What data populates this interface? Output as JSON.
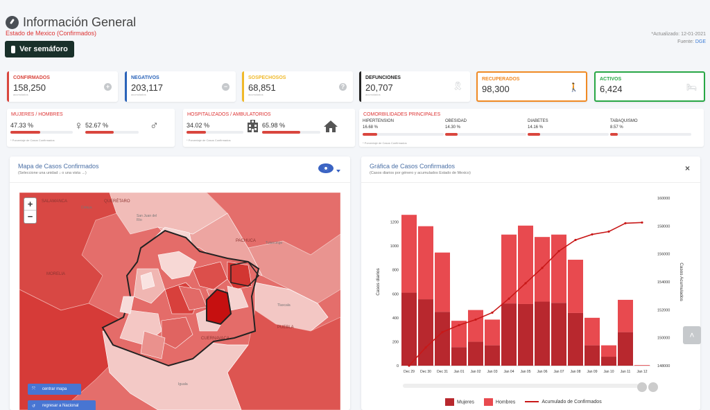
{
  "header": {
    "title": "Información General",
    "subtitle": "Estado de Mexico (Confirmados)",
    "semaforo_button": "Ver semáforo",
    "updated": "*Actualizado: 12-01-2021",
    "source_label": "Fuente:",
    "source_link": "DGE"
  },
  "kpis": [
    {
      "label": "CONFIRMADOS",
      "value": "158,250",
      "note": "acumulados",
      "color": "#d9463e",
      "icon": "plus-circle-icon",
      "glyph": "+"
    },
    {
      "label": "NEGATIVOS",
      "value": "203,117",
      "note": "acumulados",
      "color": "#2a63b9",
      "icon": "minus-circle-icon",
      "glyph": "−"
    },
    {
      "label": "SOSPECHOSOS",
      "value": "68,851",
      "note": "acumulados",
      "color": "#f0b929",
      "icon": "question-circle-icon",
      "glyph": "?"
    },
    {
      "label": "DEFUNCIONES",
      "value": "20,707",
      "note": "acumulados",
      "color": "#222222",
      "icon": "ribbon-icon",
      "glyph": "🎗"
    },
    {
      "label": "RECUPERADOS",
      "value": "98,300",
      "note": "",
      "color": "#f08a24",
      "icon": "walking-icon",
      "glyph": "🚶"
    },
    {
      "label": "ACTIVOS",
      "value": "6,424",
      "note": "",
      "color": "#28a745",
      "icon": "bed-icon",
      "glyph": "🛏"
    }
  ],
  "gender": {
    "title": "MUJERES / HOMBRES",
    "women_pct": "47.33 %",
    "women_value": 47.33,
    "men_pct": "52.67 %",
    "men_value": 52.67,
    "note": "* Porcentaje de Casos Confirmados",
    "women_symbol": "♀",
    "men_symbol": "♂"
  },
  "hosp": {
    "title": "HOSPITALIZADOS / AMBULATORIOS",
    "hosp_pct": "34.02 %",
    "hosp_value": 34.02,
    "amb_pct": "65.98 %",
    "amb_value": 65.98,
    "note": "* Porcentaje de Casos Confirmados",
    "hosp_icon": "hospital-icon",
    "amb_icon": "house-icon"
  },
  "comorb": {
    "title": "COMORBILIDADES PRINCIPALES",
    "note": "* Porcentaje de Casos Confirmados",
    "items": [
      {
        "label": "HIPERTENSION",
        "pct": "16.68 %",
        "value": 16.68
      },
      {
        "label": "OBESIDAD",
        "pct": "14.30 %",
        "value": 14.3
      },
      {
        "label": "DIABETES",
        "pct": "14.16 %",
        "value": 14.16
      },
      {
        "label": "TABAQUISMO",
        "pct": "8.57 %",
        "value": 8.57
      }
    ]
  },
  "map_card": {
    "title": "Mapa de Casos Confirmados",
    "subtitle": "(Seleccione una unidad ↓ o una vista →)",
    "zoom_in": "+",
    "zoom_out": "−",
    "center_button": "centrar mapa",
    "back_button": "regresar a Nacional",
    "labels": [
      {
        "text": "SALAMANCA",
        "cls": "big"
      },
      {
        "text": "QUERÉTARO",
        "cls": "big"
      },
      {
        "text": "Celaya",
        "cls": "s"
      },
      {
        "text": "San Juan del Río",
        "cls": "s"
      },
      {
        "text": "PACHUCA",
        "cls": "big"
      },
      {
        "text": "Tulancingo",
        "cls": "s"
      },
      {
        "text": "MORELIA",
        "cls": "big"
      },
      {
        "text": "Tlaxcala",
        "cls": "s"
      },
      {
        "text": "PUEBLA",
        "cls": "big"
      },
      {
        "text": "CUERNAVACA",
        "cls": "big"
      },
      {
        "text": "Iguala",
        "cls": "s"
      }
    ]
  },
  "chart_card": {
    "title": "Gráfica de Casos Confirmados",
    "subtitle": "(Casos diarios por género y acumulados Estado de Mexico)",
    "close": "×",
    "scroll_top": "˄"
  },
  "chart_data": {
    "type": "bar",
    "categories": [
      "Dec 29",
      "Dec 30",
      "Dec 31",
      "Jan 01",
      "Jan 02",
      "Jan 03",
      "Jan 04",
      "Jan 05",
      "Jan 06",
      "Jan 07",
      "Jan 08",
      "Jan 09",
      "Jan 10",
      "Jan 11",
      "Jan 12"
    ],
    "series": [
      {
        "name": "Mujeres",
        "values": [
          610,
          555,
          450,
          155,
          200,
          170,
          520,
          515,
          535,
          525,
          440,
          170,
          75,
          280,
          0
        ],
        "color": "#b8282e"
      },
      {
        "name": "Hombres",
        "values": [
          650,
          610,
          495,
          220,
          265,
          215,
          575,
          655,
          540,
          570,
          445,
          230,
          95,
          270,
          5
        ],
        "color": "#e84a4f"
      },
      {
        "name": "Acumulado de Confirmados",
        "values": [
          148000,
          149300,
          150400,
          150900,
          151300,
          151800,
          152800,
          153900,
          155000,
          156200,
          157000,
          157400,
          157600,
          158200,
          158250
        ],
        "color": "#c81818",
        "axis": "right"
      }
    ],
    "ylabel": "Casos diarios",
    "y2label": "Casos Acumulados",
    "ylim": [
      0,
      1400
    ],
    "yticks": [
      0,
      200,
      400,
      600,
      800,
      1000,
      1200
    ],
    "y2lim": [
      148000,
      160000
    ],
    "y2ticks": [
      "148000",
      "150000",
      "152000",
      "154000",
      "156000",
      "158000",
      "160000"
    ],
    "legend_position": "bottom"
  }
}
